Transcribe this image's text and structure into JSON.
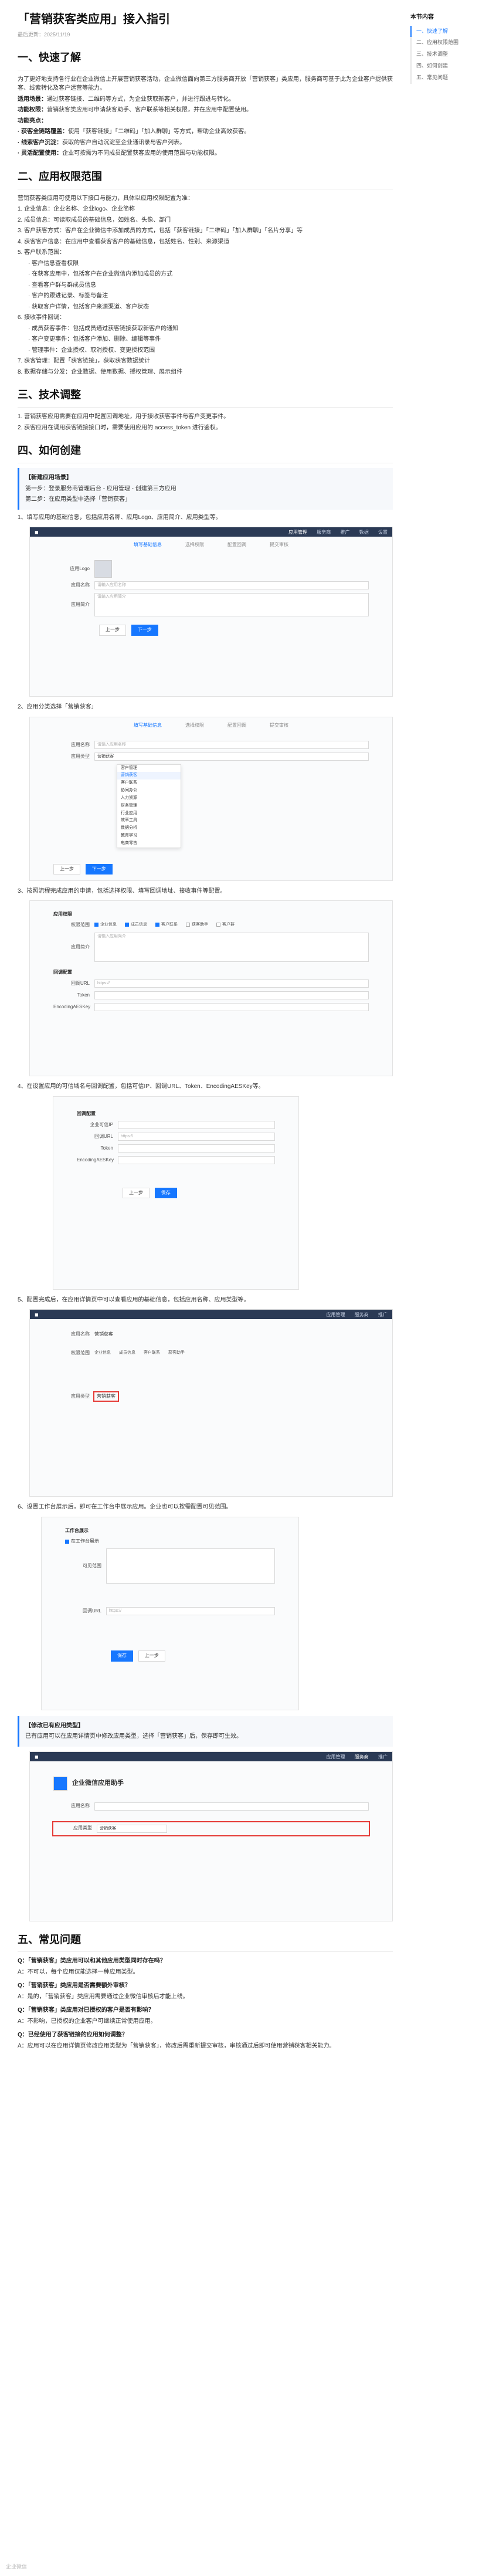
{
  "article": {
    "title": "「营销获客类应用」接入指引",
    "meta": "最后更新：2025/11/19"
  },
  "toc": {
    "title": "本节内容",
    "items": [
      "一、快速了解",
      "二、应用权限范围",
      "三、技术调整",
      "四、如何创建",
      "五、常见问题"
    ]
  },
  "s1": {
    "heading": "一、快速了解",
    "intro": "为了更好地支持各行业在企业微信上开展营销获客活动，企业微信面向第三方服务商开放「营销获客」类应用，服务商可基于此为企业客户提供获客、线索转化及客户运营等能力。",
    "items": [
      {
        "label": "适用场景：",
        "text": "通过获客链接、二维码等方式，为企业获取新客户，并进行跟进与转化。"
      },
      {
        "label": "功能权限：",
        "text": "营销获客类应用可申请获客助手、客户联系等相关权限，并在应用中配置使用。"
      }
    ],
    "value_title": "功能亮点：",
    "values": [
      {
        "label": "· 获客全链路覆盖：",
        "text": "使用「获客链接」「二维码」「加入群聊」等方式，帮助企业高效获客。"
      },
      {
        "label": "· 线索客户沉淀：",
        "text": "获取的客户自动沉淀至企业通讯录与客户列表。"
      },
      {
        "label": "· 灵活配置使用：",
        "text": "企业可按需为不同成员配置获客应用的使用范围与功能权限。"
      }
    ]
  },
  "s2": {
    "heading": "二、应用权限范围",
    "intro": "营销获客类应用可使用以下接口与能力，具体以应用权限配置为准：",
    "list": [
      "1. 企业信息：企业名称、企业logo、企业简称",
      "2. 成员信息：可读取成员的基础信息，如姓名、头像、部门",
      "3. 客户获客方式：客户在企业微信中添加成员的方式，包括「获客链接」「二维码」「加入群聊」「名片分享」等",
      "4. 获客客户信息：在应用中查看获客客户的基础信息，包括姓名、性别、来源渠道",
      "5. 客户联系范围：",
      "6. 接收事件回调：",
      "7. 获客管理：配置「获客链接」，获取获客数据统计",
      "8. 数据存储与分发：企业数据、使用数据、授权管理、展示组件"
    ],
    "sub5": [
      "· 客户信息查看权限",
      "· 在获客应用中，包括客户在企业微信内添加成员的方式",
      "· 查看客户群与群成员信息",
      "· 客户的跟进记录、标签与备注",
      "· 获取客户详情，包括客户来源渠道、客户状态"
    ],
    "sub6": [
      "· 成员获客事件：包括成员通过获客链接获取新客户的通知",
      "· 客户变更事件：包括客户添加、删除、编辑等事件",
      "· 管理事件：企业授权、取消授权、变更授权范围"
    ]
  },
  "s3": {
    "heading": "三、技术调整",
    "items": [
      "1. 营销获客应用需要在应用中配置回调地址，用于接收获客事件与客户变更事件。",
      "2. 获客应用在调用获客链接接口时，需要使用应用的 access_token 进行鉴权。"
    ]
  },
  "s4": {
    "heading": "四、如何创建",
    "box_title": "【新建应用场景】",
    "box_lines": [
      "第一步：登录服务商管理后台 - 应用管理 - 创建第三方应用",
      "第二步：在应用类型中选择「营销获客」"
    ],
    "step1": "1、填写应用的基础信息，包括应用名称、应用Logo、应用简介、应用类型等。",
    "step2": "2、应用分类选择「营销获客」",
    "step3": "3、按照流程完成应用的申请，包括选择权限、填写回调地址、接收事件等配置。",
    "step4": "4、在设置应用的可信域名与回调配置，包括可信IP、回调URL、Token、EncodingAESKey等。",
    "step5": "5、配置完成后，在应用详情页中可以查看应用的基础信息，包括应用名称、应用类型等。",
    "step6": "6、设置工作台展示后，即可在工作台中展示应用。企业也可以按需配置可见范围。",
    "box2_title": "【修改已有应用类型】",
    "box2_text": "已有应用可以在应用详情页中修改应用类型，选择「营销获客」后，保存即可生效。"
  },
  "mock": {
    "nav_tabs": [
      "应用管理",
      "服务商",
      "推广",
      "数据",
      "设置"
    ],
    "steps": [
      "填写基础信息",
      "选择权限",
      "配置回调",
      "提交审核"
    ],
    "f_logo": "应用Logo",
    "f_name": "应用名称",
    "f_name_ph": "请输入应用名称",
    "f_desc": "应用简介",
    "f_desc_ph": "请输入应用简介",
    "f_cat": "应用类型",
    "f_cat_sel": "营销获客",
    "dropdown": [
      "客户管理",
      "营销获客",
      "客户联系",
      "协同办公",
      "人力资源",
      "财务管理",
      "行业应用",
      "效率工具",
      "数据分析",
      "教育学习",
      "电商零售"
    ],
    "btn_prev": "上一步",
    "btn_next": "下一步",
    "btn_save": "保存",
    "perm_title": "应用权限",
    "perm_label": "权限范围",
    "perms": [
      "企业信息",
      "成员信息",
      "客户联系",
      "获客助手",
      "客户群"
    ],
    "cb_title": "回调配置",
    "cb_url": "回调URL",
    "cb_url_ph": "https://",
    "cb_token": "Token",
    "cb_aes": "EncodingAESKey",
    "cb_ip": "企业可信IP",
    "app_name": "营销获客",
    "app_type_label": "应用类型",
    "app_type_value": "营销获客",
    "ws_title": "工作台展示",
    "ws_show": "在工作台展示",
    "ws_range": "可见范围",
    "helper_title": "企业微信应用助手",
    "helper_type": "营销获客"
  },
  "s5": {
    "heading": "五、常见问题",
    "qa": [
      {
        "q": "Q：「营销获客」类应用可以和其他应用类型同时存在吗？",
        "a": "A：不可以，每个应用仅能选择一种应用类型。"
      },
      {
        "q": "Q：「营销获客」类应用是否需要额外审核？",
        "a": "A：是的，「营销获客」类应用需要通过企业微信审核后才能上线。"
      },
      {
        "q": "Q：「营销获客」类应用对已授权的客户是否有影响？",
        "a": "A：不影响，已授权的企业客户可继续正常使用应用。"
      },
      {
        "q": "Q：已经使用了获客链接的应用如何调整？",
        "a": "A：应用可以在应用详情页修改应用类型为「营销获客」，修改后需重新提交审核，审核通过后即可使用营销获客相关能力。"
      }
    ]
  },
  "footer": "企业微信"
}
